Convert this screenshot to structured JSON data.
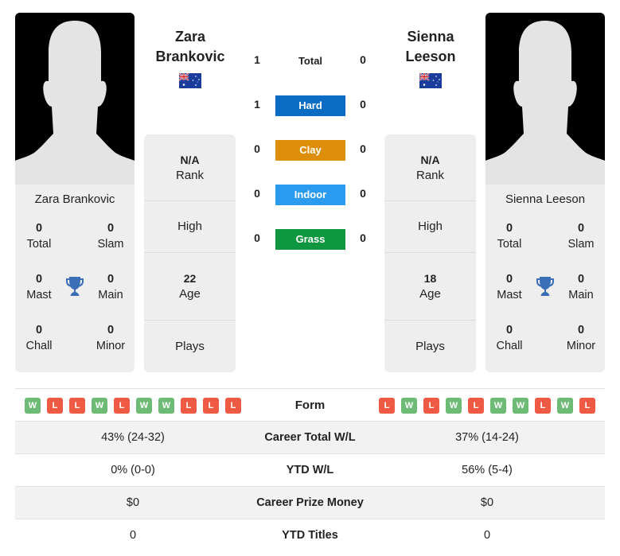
{
  "players": [
    {
      "name": "Zara Brankovic",
      "name_line1": "Zara",
      "name_line2": "Brankovic",
      "country_flag": "australia-flag",
      "titles": {
        "total": {
          "value": "0",
          "label": "Total"
        },
        "slam": {
          "value": "0",
          "label": "Slam"
        },
        "mast": {
          "value": "0",
          "label": "Mast"
        },
        "main": {
          "value": "0",
          "label": "Main"
        },
        "chall": {
          "value": "0",
          "label": "Chall"
        },
        "minor": {
          "value": "0",
          "label": "Minor"
        }
      },
      "info": {
        "rank": {
          "value": "N/A",
          "label": "Rank"
        },
        "high": {
          "value": "",
          "label": "High"
        },
        "age": {
          "value": "22",
          "label": "Age"
        },
        "plays": {
          "value": "",
          "label": "Plays"
        }
      },
      "form": [
        "W",
        "L",
        "L",
        "W",
        "L",
        "W",
        "W",
        "L",
        "L",
        "L"
      ]
    },
    {
      "name": "Sienna Leeson",
      "name_line1": "Sienna",
      "name_line2": "Leeson",
      "country_flag": "australia-flag",
      "titles": {
        "total": {
          "value": "0",
          "label": "Total"
        },
        "slam": {
          "value": "0",
          "label": "Slam"
        },
        "mast": {
          "value": "0",
          "label": "Mast"
        },
        "main": {
          "value": "0",
          "label": "Main"
        },
        "chall": {
          "value": "0",
          "label": "Chall"
        },
        "minor": {
          "value": "0",
          "label": "Minor"
        }
      },
      "info": {
        "rank": {
          "value": "N/A",
          "label": "Rank"
        },
        "high": {
          "value": "",
          "label": "High"
        },
        "age": {
          "value": "18",
          "label": "Age"
        },
        "plays": {
          "value": "",
          "label": "Plays"
        }
      },
      "form": [
        "L",
        "W",
        "L",
        "W",
        "L",
        "W",
        "W",
        "L",
        "W",
        "L"
      ]
    }
  ],
  "h2h": [
    {
      "label": "Total",
      "left": "1",
      "right": "0",
      "color": ""
    },
    {
      "label": "Hard",
      "left": "1",
      "right": "0",
      "color": "#0a6cc2"
    },
    {
      "label": "Clay",
      "left": "0",
      "right": "0",
      "color": "#dd8e0a"
    },
    {
      "label": "Indoor",
      "left": "0",
      "right": "0",
      "color": "#2b9bf0"
    },
    {
      "label": "Grass",
      "left": "0",
      "right": "0",
      "color": "#0e9641"
    }
  ],
  "comparison": {
    "form_label": "Form",
    "rows": [
      {
        "label": "Career Total W/L",
        "left": "43% (24-32)",
        "right": "37% (14-24)"
      },
      {
        "label": "YTD W/L",
        "left": "0% (0-0)",
        "right": "56% (5-4)"
      },
      {
        "label": "Career Prize Money",
        "left": "$0",
        "right": "$0"
      },
      {
        "label": "YTD Titles",
        "left": "0",
        "right": "0"
      }
    ]
  },
  "colors": {
    "win": "#6dbb75",
    "loss": "#ee5a44",
    "trophy": "#3a6fb8",
    "card_bg": "#eeeeee"
  }
}
